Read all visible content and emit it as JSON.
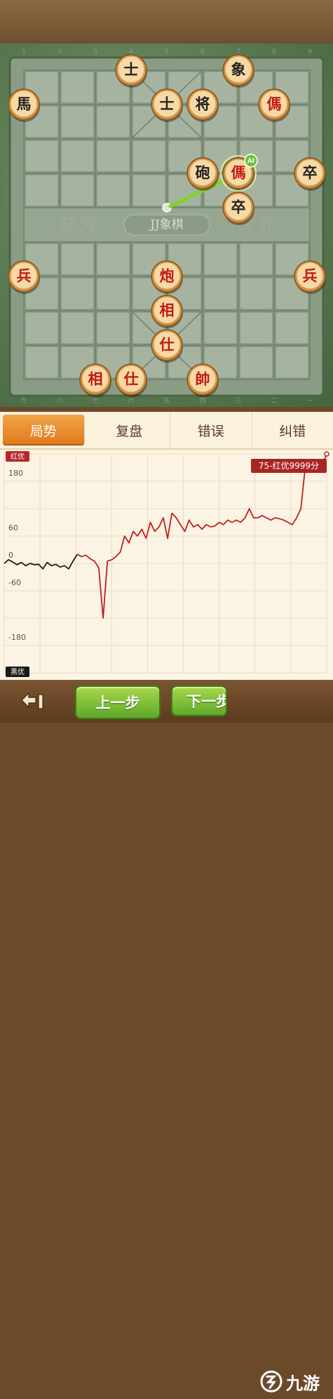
{
  "board": {
    "file_labels_top": [
      "1",
      "2",
      "3",
      "4",
      "5",
      "6",
      "7",
      "8",
      "9"
    ],
    "file_labels_bottom": [
      "九",
      "八",
      "七",
      "六",
      "五",
      "四",
      "三",
      "二",
      "一"
    ],
    "river_left": "楚 河",
    "river_right": "汉 界",
    "river_logo": "JJ象棋",
    "ai_badge": "AI",
    "pieces": [
      {
        "name": "black-advisor",
        "char": "士",
        "color": "black",
        "file": 3,
        "rank": 0
      },
      {
        "name": "black-elephant",
        "char": "象",
        "color": "black",
        "file": 6,
        "rank": 0
      },
      {
        "name": "black-horse",
        "char": "馬",
        "color": "black",
        "file": 0,
        "rank": 1
      },
      {
        "name": "black-advisor",
        "char": "士",
        "color": "black",
        "file": 4,
        "rank": 1
      },
      {
        "name": "black-general",
        "char": "将",
        "color": "black",
        "file": 5,
        "rank": 1
      },
      {
        "name": "red-horse",
        "char": "傌",
        "color": "red",
        "file": 7,
        "rank": 1
      },
      {
        "name": "black-cannon",
        "char": "砲",
        "color": "black",
        "file": 5,
        "rank": 3
      },
      {
        "name": "red-horse",
        "char": "傌",
        "color": "red",
        "file": 6,
        "rank": 3
      },
      {
        "name": "black-soldier",
        "char": "卒",
        "color": "black",
        "file": 8,
        "rank": 3
      },
      {
        "name": "black-soldier",
        "char": "卒",
        "color": "black",
        "file": 6,
        "rank": 4
      },
      {
        "name": "red-soldier",
        "char": "兵",
        "color": "red",
        "file": 0,
        "rank": 6
      },
      {
        "name": "red-cannon",
        "char": "炮",
        "color": "red",
        "file": 4,
        "rank": 6
      },
      {
        "name": "red-soldier",
        "char": "兵",
        "color": "red",
        "file": 8,
        "rank": 6
      },
      {
        "name": "red-elephant",
        "char": "相",
        "color": "red",
        "file": 4,
        "rank": 7
      },
      {
        "name": "red-advisor",
        "char": "仕",
        "color": "red",
        "file": 4,
        "rank": 8
      },
      {
        "name": "red-elephant",
        "char": "相",
        "color": "red",
        "file": 2,
        "rank": 9
      },
      {
        "name": "red-advisor",
        "char": "仕",
        "color": "red",
        "file": 3,
        "rank": 9
      },
      {
        "name": "red-king",
        "char": "帥",
        "color": "red",
        "file": 5,
        "rank": 9
      }
    ],
    "hint_arrow": {
      "from_file": 4,
      "from_rank": 4,
      "to_file": 6,
      "to_rank": 3
    }
  },
  "tabs": [
    {
      "label": "局势",
      "active": true
    },
    {
      "label": "复盘",
      "active": false
    },
    {
      "label": "错误",
      "active": false
    },
    {
      "label": "纠错",
      "active": false
    }
  ],
  "chart_data": {
    "type": "line",
    "top_tag": "红优",
    "bottom_tag": "黑优",
    "callout": "75-红优9999分",
    "ylim": [
      -240,
      240
    ],
    "yticks": [
      180,
      60,
      0,
      -60,
      -180
    ],
    "ytick_labels": [
      "180",
      "60",
      "0",
      "-60",
      "-180"
    ],
    "series": [
      {
        "color": "#1a1a1a",
        "points": [
          [
            0,
            0
          ],
          [
            1,
            8
          ],
          [
            2,
            3
          ],
          [
            3,
            -3
          ],
          [
            4,
            2
          ],
          [
            5,
            -5
          ],
          [
            6,
            0
          ],
          [
            7,
            -3
          ],
          [
            8,
            -2
          ],
          [
            9,
            -12
          ],
          [
            10,
            2
          ],
          [
            11,
            -5
          ],
          [
            12,
            -2
          ],
          [
            13,
            -8
          ],
          [
            14,
            -5
          ],
          [
            15,
            -12
          ],
          [
            16,
            5
          ],
          [
            17,
            20
          ]
        ]
      },
      {
        "color": "#c02020",
        "points": [
          [
            17,
            20
          ],
          [
            18,
            15
          ],
          [
            19,
            18
          ],
          [
            20,
            10
          ],
          [
            21,
            5
          ],
          [
            22,
            -10
          ],
          [
            23,
            -120
          ],
          [
            24,
            5
          ],
          [
            25,
            8
          ],
          [
            26,
            15
          ],
          [
            27,
            25
          ],
          [
            28,
            60
          ],
          [
            29,
            45
          ],
          [
            30,
            70
          ],
          [
            31,
            60
          ],
          [
            32,
            75
          ],
          [
            33,
            55
          ],
          [
            34,
            90
          ],
          [
            35,
            70
          ],
          [
            36,
            80
          ],
          [
            37,
            100
          ],
          [
            38,
            55
          ],
          [
            39,
            110
          ],
          [
            40,
            100
          ],
          [
            41,
            85
          ],
          [
            42,
            70
          ],
          [
            43,
            95
          ],
          [
            44,
            80
          ],
          [
            45,
            85
          ],
          [
            46,
            75
          ],
          [
            47,
            85
          ],
          [
            48,
            80
          ],
          [
            49,
            82
          ],
          [
            50,
            90
          ],
          [
            51,
            85
          ],
          [
            52,
            95
          ],
          [
            53,
            90
          ],
          [
            54,
            95
          ],
          [
            55,
            90
          ],
          [
            56,
            100
          ],
          [
            57,
            120
          ],
          [
            58,
            100
          ],
          [
            59,
            100
          ],
          [
            60,
            105
          ],
          [
            61,
            100
          ],
          [
            62,
            95
          ],
          [
            63,
            100
          ],
          [
            64,
            98
          ],
          [
            65,
            95
          ],
          [
            66,
            90
          ],
          [
            67,
            85
          ],
          [
            68,
            100
          ],
          [
            69,
            120
          ],
          [
            70,
            210
          ],
          [
            71,
            215
          ],
          [
            72,
            210
          ],
          [
            73,
            210
          ],
          [
            74,
            215
          ],
          [
            75,
            240
          ]
        ]
      }
    ],
    "grid": true
  },
  "buttons": {
    "back_icon": "back-arrow-icon",
    "prev_label": "上一步",
    "next_label": "下一步"
  },
  "watermark": {
    "text": "九游"
  }
}
